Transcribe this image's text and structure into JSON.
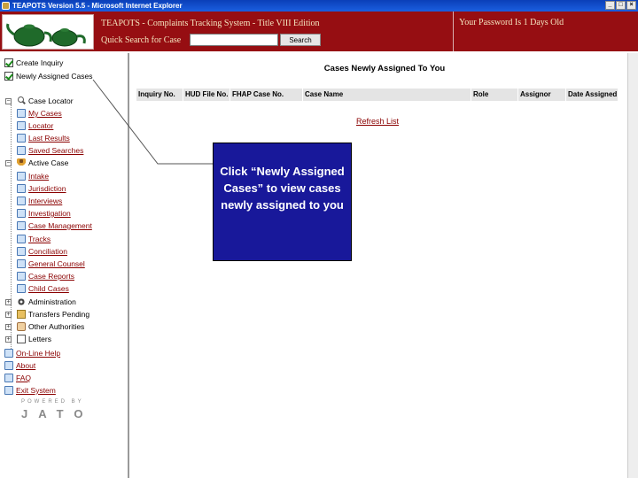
{
  "window": {
    "title": "TEAPOTS Version 5.5 - Microsoft Internet Explorer",
    "min": "_",
    "max": "□",
    "close": "×"
  },
  "header": {
    "app_title": "TEAPOTS - Complaints Tracking System - Title VIII Edition",
    "search_label": "Quick Search for Case",
    "search_value": "",
    "search_button": "Search",
    "password_message": "Your Password Is 1 Days Old",
    "brand_color": "#960e12"
  },
  "sidebar": {
    "create_inquiry": "Create Inquiry",
    "newly_assigned": "Newly Assigned Cases",
    "case_locator": "Case Locator",
    "my_cases": "My Cases",
    "locator": "Locator",
    "last_results": "Last Results",
    "saved_searches": "Saved Searches",
    "active_case": "Active Case",
    "intake": "Intake",
    "jurisdiction": "Jurisdiction",
    "interviews": "Interviews",
    "investigation": "Investigation",
    "case_management": "Case Management",
    "tracks": "Tracks",
    "conciliation": "Conciliation",
    "general_counsel": "General Counsel",
    "case_reports": "Case Reports",
    "child_cases": "Child Cases",
    "administration": "Administration",
    "transfers_pending": "Transfers Pending",
    "other_authorities": "Other Authorities",
    "letters": "Letters",
    "online_help": "On-Line Help",
    "about": "About",
    "faq": "FAQ",
    "exit_system": "Exit System",
    "powered_by": "POWERED BY",
    "jato": "JATO"
  },
  "main": {
    "title": "Cases Newly Assigned To You",
    "columns": [
      "Inquiry No.",
      "HUD File No.",
      "FHAP Case No.",
      "Case Name",
      "Role",
      "Assignor",
      "Date Assigned"
    ],
    "refresh": "Refresh List"
  },
  "callout": {
    "text": "Click “Newly Assigned Cases” to view cases newly assigned to you",
    "color": "#18189a"
  }
}
